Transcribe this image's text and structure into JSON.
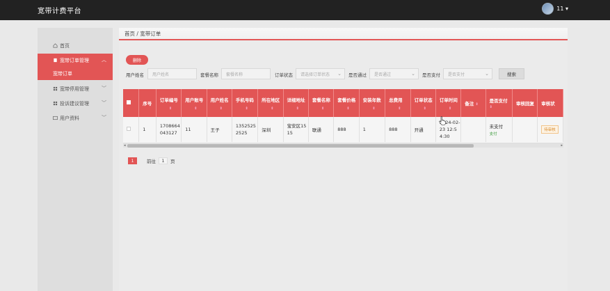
{
  "app": {
    "title": "宽带计费平台"
  },
  "user": {
    "name": "11 ▾"
  },
  "sidebar": {
    "items": [
      {
        "label": "首页"
      },
      {
        "label": "宽带订单管理"
      },
      {
        "label": "宽带订单"
      },
      {
        "label": "宽带停用管理"
      },
      {
        "label": "投诉建议管理"
      },
      {
        "label": "用户资料"
      }
    ]
  },
  "breadcrumb": "首页 / 宽带订单",
  "toolbar": {
    "delete_label": "删除",
    "search_label": "搜索"
  },
  "filters": {
    "user_name": {
      "label": "用户姓名",
      "placeholder": "用户姓名"
    },
    "package_name": {
      "label": "套餐名称",
      "placeholder": "套餐名称"
    },
    "order_status": {
      "label": "订单状态",
      "placeholder": "请选择订单状态"
    },
    "approved": {
      "label": "是否通过",
      "placeholder": "是否通过"
    },
    "paid": {
      "label": "是否支付",
      "placeholder": "是否支付"
    }
  },
  "table": {
    "headers": [
      "序号",
      "订单编号",
      "用户账号",
      "用户姓名",
      "手机号码",
      "所在地区",
      "详细地址",
      "套餐名称",
      "套餐价格",
      "安装年数",
      "总费用",
      "订单状态",
      "订单时间",
      "备注",
      "是否支付",
      "审核回复",
      "审核状"
    ],
    "rows": [
      {
        "index": "1",
        "order_no": "1708664043127",
        "account": "11",
        "name": "王子",
        "phone": "13525252525",
        "region": "深圳",
        "address": "宝安区1515",
        "package": "联通",
        "price": "888",
        "years": "1",
        "total": "888",
        "status": "开通",
        "time": "2024-02-23 12:54:30",
        "remark": "",
        "paid": "未支付",
        "pay_action": "支付",
        "review_reply": "",
        "review_state": "待审核"
      }
    ]
  },
  "pager": {
    "current": "1",
    "goto_label": "前往",
    "goto_value": "1",
    "page_label": "页"
  },
  "colors": {
    "accent": "#e25555",
    "topbar": "#222222"
  }
}
